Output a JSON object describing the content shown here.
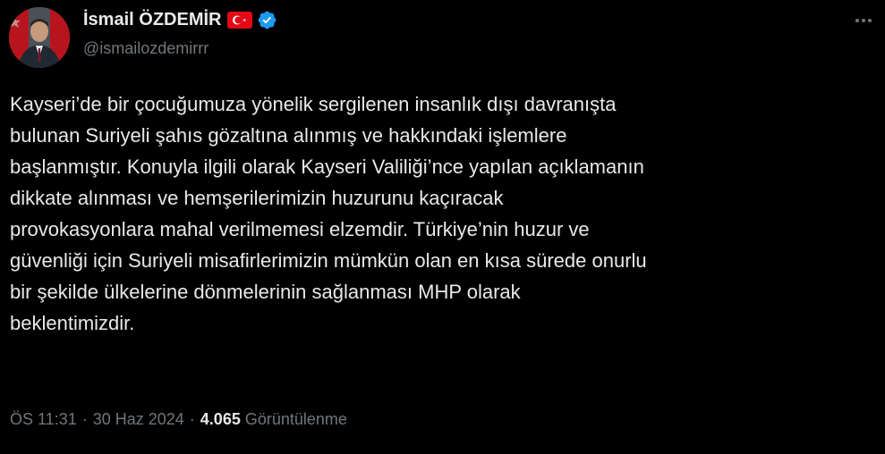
{
  "author": {
    "display_name": "İsmail ÖZDEMİR",
    "handle": "@ismailozdemirrr",
    "flag_icon": "turkey-flag-icon",
    "verified_icon": "verified-badge-icon",
    "verified_color": "#1d9bf0"
  },
  "tweet": {
    "lines": [
      "Kayseri’de bir çocuğumuza yönelik sergilenen insanlık dışı davranışta",
      "bulunan Suriyeli şahıs gözaltına alınmış ve hakkındaki işlemlere",
      "başlanmıştır. Konuyla ilgili olarak Kayseri Valiliği’nce yapılan açıklamanın",
      "dikkate alınması ve hemşerilerimizin huzurunu kaçıracak",
      "provokasyonlara mahal verilmemesi elzemdir. Türkiye’nin huzur ve",
      "güvenliği için Suriyeli misafirlerimizin mümkün olan en kısa sürede onurlu",
      "bir şekilde ülkelerine dönmelerinin sağlanması MHP olarak",
      "beklentimizdir."
    ]
  },
  "meta": {
    "time": "ÖS 11:31",
    "separator": "·",
    "date": "30 Haz 2024",
    "views_count": "4.065",
    "views_label": "Görüntülenme"
  },
  "colors": {
    "background": "#000000",
    "text_primary": "#e7e9ea",
    "text_secondary": "#71767b",
    "flag_red": "#e30a17"
  }
}
